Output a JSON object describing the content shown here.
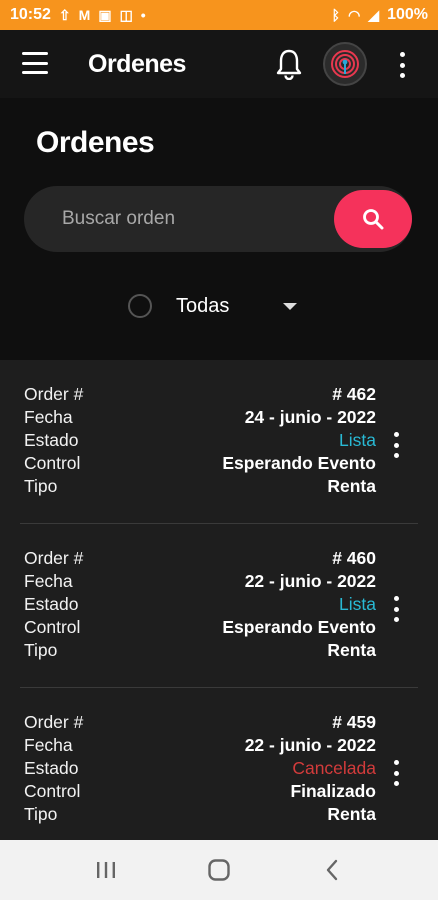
{
  "status_bar": {
    "time": "10:52",
    "notification_icons": [
      "upload-icon",
      "gmail-icon",
      "calendar-icon",
      "image-icon",
      "dot-icon"
    ],
    "system_icons": [
      "bluetooth-icon",
      "wifi-icon",
      "signal-icon",
      "battery-icon"
    ],
    "battery": "100%"
  },
  "app_bar": {
    "title": "Ordenes"
  },
  "hero": {
    "title": "Ordenes",
    "search": {
      "placeholder": "Buscar orden",
      "value": ""
    },
    "filter": {
      "selected": "Todas"
    }
  },
  "orders": [
    {
      "rows": [
        {
          "label": "Order #",
          "value": "# 462"
        },
        {
          "label": "Fecha",
          "value": "24 - junio - 2022"
        },
        {
          "label": "Estado",
          "value": "Lista"
        },
        {
          "label": "Control",
          "value": "Esperando Evento"
        },
        {
          "label": "Tipo",
          "value": "Renta"
        }
      ]
    },
    {
      "rows": [
        {
          "label": "Order #",
          "value": "# 460"
        },
        {
          "label": "Fecha",
          "value": "22 - junio - 2022"
        },
        {
          "label": "Estado",
          "value": "Lista"
        },
        {
          "label": "Control",
          "value": "Esperando Evento"
        },
        {
          "label": "Tipo",
          "value": "Renta"
        }
      ]
    },
    {
      "rows": [
        {
          "label": "Order #",
          "value": "# 459"
        },
        {
          "label": "Fecha",
          "value": "22 - junio - 2022"
        },
        {
          "label": "Estado",
          "value": "Cancelada"
        },
        {
          "label": "Control",
          "value": "Finalizado"
        },
        {
          "label": "Tipo",
          "value": "Renta"
        }
      ]
    }
  ],
  "colors": {
    "status_bar": "#f7941d",
    "accent": "#f5325b",
    "lista": "#29b9d4",
    "cancelada": "#d23b3b"
  }
}
